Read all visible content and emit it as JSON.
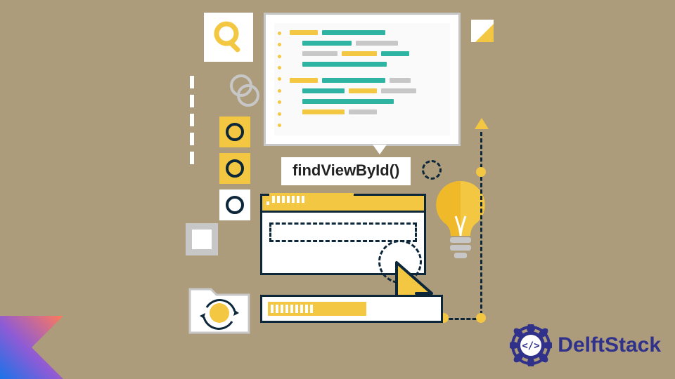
{
  "label": "findViewById()",
  "brand_text": "DelftStack",
  "colors": {
    "background": "#ac9c7c",
    "accent_yellow": "#f4c742",
    "accent_teal": "#2fb4a3",
    "dark": "#0c263a",
    "brand_blue": "#2f318a"
  },
  "icons": {
    "corner_logo": "kotlin",
    "brand_badge": "code-rosette"
  }
}
